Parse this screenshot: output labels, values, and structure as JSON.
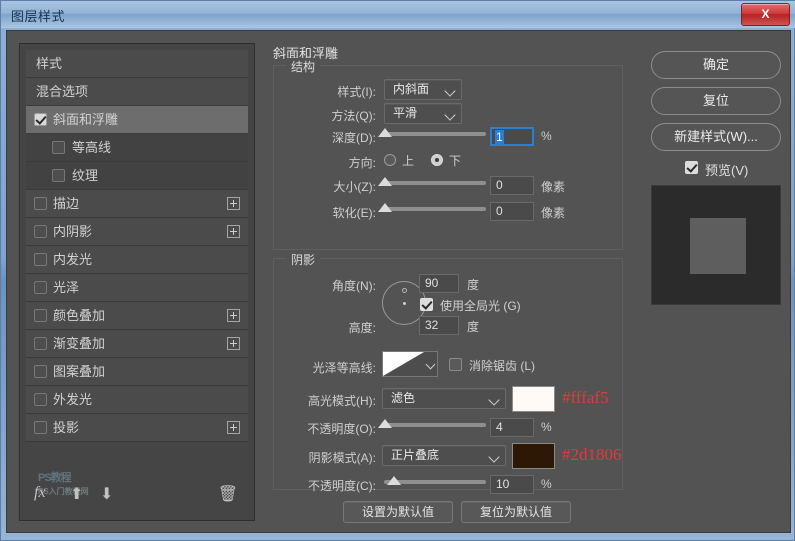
{
  "window": {
    "title": "图层样式",
    "close_label": "X"
  },
  "sidebar": {
    "items": [
      {
        "label": "样式",
        "checkbox": null,
        "plus": false,
        "state": "plain",
        "indent": false
      },
      {
        "label": "混合选项",
        "checkbox": null,
        "plus": false,
        "state": "plain",
        "indent": false
      },
      {
        "label": "斜面和浮雕",
        "checkbox": true,
        "plus": false,
        "state": "active",
        "indent": false
      },
      {
        "label": "等高线",
        "checkbox": false,
        "plus": false,
        "state": "sub",
        "indent": true
      },
      {
        "label": "纹理",
        "checkbox": false,
        "plus": false,
        "state": "sub",
        "indent": true
      },
      {
        "label": "描边",
        "checkbox": false,
        "plus": true,
        "state": "plain",
        "indent": false
      },
      {
        "label": "内阴影",
        "checkbox": false,
        "plus": true,
        "state": "plain",
        "indent": false
      },
      {
        "label": "内发光",
        "checkbox": false,
        "plus": false,
        "state": "plain",
        "indent": false
      },
      {
        "label": "光泽",
        "checkbox": false,
        "plus": false,
        "state": "plain",
        "indent": false
      },
      {
        "label": "颜色叠加",
        "checkbox": false,
        "plus": true,
        "state": "plain",
        "indent": false
      },
      {
        "label": "渐变叠加",
        "checkbox": false,
        "plus": true,
        "state": "plain",
        "indent": false
      },
      {
        "label": "图案叠加",
        "checkbox": false,
        "plus": false,
        "state": "plain",
        "indent": false
      },
      {
        "label": "外发光",
        "checkbox": false,
        "plus": false,
        "state": "plain",
        "indent": false
      },
      {
        "label": "投影",
        "checkbox": false,
        "plus": true,
        "state": "plain",
        "indent": false
      }
    ],
    "toolbar": {
      "fx_icon": "fx-icon",
      "up_icon": "arrow-up-icon",
      "down_icon": "arrow-down-icon",
      "trash_icon": "trash-icon",
      "fx_glyph": "fx",
      "up_glyph": "⬆",
      "down_glyph": "⬇",
      "trash_glyph": "🗑"
    },
    "watermark": {
      "line1": "PS教程",
      "line2": "PS入门教程网"
    }
  },
  "main": {
    "panel_title": "斜面和浮雕",
    "structure": {
      "legend": "结构",
      "style_label": "样式(I):",
      "style_value": "内斜面",
      "technique_label": "方法(Q):",
      "technique_value": "平滑",
      "depth_label": "深度(D):",
      "depth_value": "1",
      "depth_unit": "%",
      "direction_label": "方向:",
      "direction_up": "上",
      "direction_down": "下",
      "direction_selected": "下",
      "size_label": "大小(Z):",
      "size_value": "0",
      "size_unit": "像素",
      "soften_label": "软化(E):",
      "soften_value": "0",
      "soften_unit": "像素"
    },
    "shading": {
      "legend": "阴影",
      "angle_label": "角度(N):",
      "angle_value": "90",
      "angle_unit": "度",
      "global_light_label": "使用全局光 (G)",
      "global_light_checked": true,
      "altitude_label": "高度:",
      "altitude_value": "32",
      "altitude_unit": "度",
      "gloss_contour_label": "光泽等高线:",
      "antialias_label": "消除锯齿 (L)",
      "antialias_checked": false,
      "highlight_mode_label": "高光模式(H):",
      "highlight_mode_value": "滤色",
      "highlight_color": "#fffaf5",
      "highlight_hex_label": "#fffaf5",
      "highlight_opacity_label": "不透明度(O):",
      "highlight_opacity_value": "4",
      "highlight_opacity_unit": "%",
      "shadow_mode_label": "阴影模式(A):",
      "shadow_mode_value": "正片叠底",
      "shadow_color": "#2d1806",
      "shadow_hex_label": "#2d1806",
      "shadow_opacity_label": "不透明度(C):",
      "shadow_opacity_value": "10",
      "shadow_opacity_unit": "%"
    },
    "footer": {
      "set_default": "设置为默认值",
      "reset_default": "复位为默认值"
    }
  },
  "right": {
    "ok_label": "确定",
    "reset_label": "复位",
    "new_style_label": "新建样式(W)...",
    "preview_label": "预览(V)",
    "preview_checked": true
  }
}
